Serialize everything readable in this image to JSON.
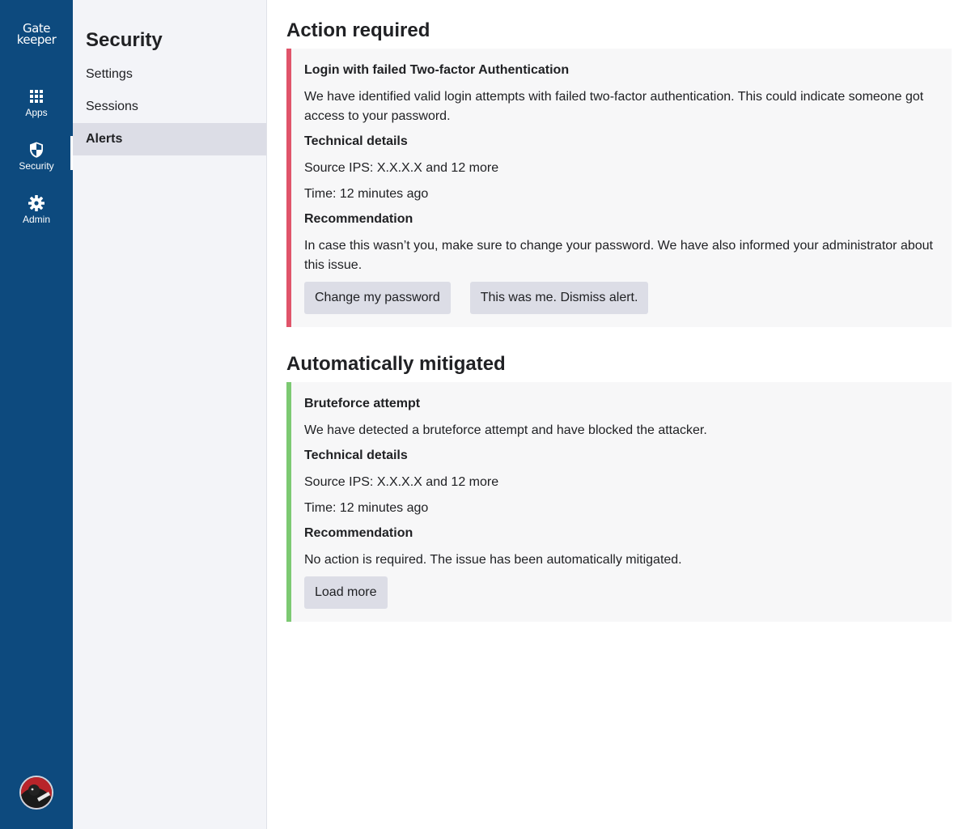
{
  "brand": {
    "logo_line1": "Gate",
    "logo_line2": "keeper"
  },
  "rail": {
    "items": [
      {
        "label": "Apps",
        "icon": "grid-icon"
      },
      {
        "label": "Security",
        "icon": "shield-icon",
        "active": true
      },
      {
        "label": "Admin",
        "icon": "gear-icon"
      }
    ]
  },
  "subnav": {
    "title": "Security",
    "items": [
      {
        "label": "Settings"
      },
      {
        "label": "Sessions"
      },
      {
        "label": "Alerts",
        "active": true
      }
    ]
  },
  "sections": {
    "action_required": {
      "title": "Action required",
      "alert": {
        "title": "Login with failed Two-factor Authentication",
        "description": "We have identified valid login attempts with failed two-factor authentication. This could indicate someone got access to your password.",
        "technical_heading": "Technical details",
        "source_ips": "Source IPS: X.X.X.X and 12 more",
        "time": "Time: 12 minutes ago",
        "recommendation_heading": "Recommendation",
        "recommendation": "In case this wasn’t you, make sure to change your password. We have also informed your administrator about this issue.",
        "primary_button": "Change my password",
        "secondary_button": "This was me. Dismiss alert."
      }
    },
    "auto_mitigated": {
      "title": "Automatically mitigated",
      "alert": {
        "title": "Bruteforce attempt",
        "description": "We have detected a bruteforce attempt and have blocked the attacker.",
        "technical_heading": "Technical details",
        "source_ips": "Source IPS: X.X.X.X and 12 more",
        "time": "Time: 12 minutes ago",
        "recommendation_heading": "Recommendation",
        "recommendation": "No action is required. The issue has been automatically mitigated.",
        "load_more": "Load more"
      }
    }
  },
  "colors": {
    "rail_bg": "#0d4a7e",
    "danger_accent": "#e0546a",
    "success_accent": "#7cc972",
    "button_bg": "#dcdde6"
  }
}
